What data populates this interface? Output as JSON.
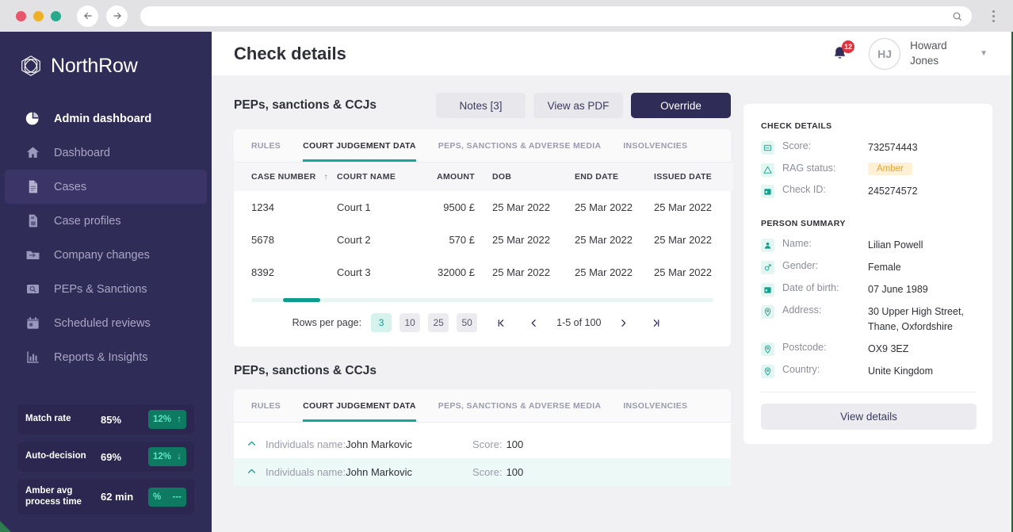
{
  "browser": {
    "back_icon": "arrow-left-icon",
    "forward_icon": "arrow-right-icon",
    "url_value": "",
    "url_placeholder": "",
    "search_icon": "search-icon",
    "menu_icon": "kebab-menu-icon"
  },
  "sidebar": {
    "brand": "NorthRow",
    "logo_icon": "northrow-hexagon-logo",
    "items": [
      {
        "label": "Admin dashboard",
        "icon": "pie-chart-icon",
        "state": "bold"
      },
      {
        "label": "Dashboard",
        "icon": "home-icon",
        "state": "normal"
      },
      {
        "label": "Cases",
        "icon": "document-icon",
        "state": "selected"
      },
      {
        "label": "Case profiles",
        "icon": "document-save-icon",
        "state": "normal"
      },
      {
        "label": "Company changes",
        "icon": "folder-transfer-icon",
        "state": "normal"
      },
      {
        "label": "PEPs & Sanctions",
        "icon": "folder-search-icon",
        "state": "normal"
      },
      {
        "label": "Scheduled reviews",
        "icon": "calendar-icon",
        "state": "normal"
      },
      {
        "label": "Reports & Insights",
        "icon": "bar-chart-icon",
        "state": "normal"
      }
    ],
    "stats": [
      {
        "label": "Match rate",
        "value": "85%",
        "delta": "12%",
        "trend": "↑"
      },
      {
        "label": "Auto-decision",
        "value": "69%",
        "delta": "12%",
        "trend": "↓"
      },
      {
        "label": "Amber avg process time",
        "value": "62 min",
        "delta": "%",
        "trend": "---"
      }
    ]
  },
  "header": {
    "title": "Check details",
    "bell_icon": "notification-bell-icon",
    "notification_count": "12",
    "avatar_initials": "HJ",
    "user_name_line1": "Howard",
    "user_name_line2": "Jones",
    "caret_icon": "chevron-down-icon"
  },
  "top_section": {
    "title": "PEPs, sanctions & CCJs",
    "buttons": {
      "notes": "Notes [3]",
      "view_pdf": "View as PDF",
      "override": "Override"
    },
    "tabs": [
      {
        "label": "Rules",
        "active": false
      },
      {
        "label": "Court judgement data",
        "active": true
      },
      {
        "label": "PEPs, sanctions & adverse media",
        "active": false
      },
      {
        "label": "Insolvencies",
        "active": false
      }
    ],
    "table": {
      "columns": [
        "Case number",
        "Court name",
        "Amount",
        "DOB",
        "End date",
        "Issued date"
      ],
      "sort_icon": "sort-ascending-icon",
      "rows": [
        [
          "1234",
          "Court 1",
          "9500 £",
          "25 Mar 2022",
          "25 Mar 2022",
          "25 Mar 2022"
        ],
        [
          "5678",
          "Court 2",
          "570 £",
          "25 Mar 2022",
          "25 Mar 2022",
          "25 Mar 2022"
        ],
        [
          "8392",
          "Court 3",
          "32000 £",
          "25 Mar 2022",
          "25 Mar 2022",
          "25 Mar 2022"
        ]
      ]
    },
    "pagination": {
      "rows_label": "Rows per page:",
      "options": [
        "3",
        "10",
        "25",
        "50"
      ],
      "selected": "3",
      "range": "1-5 of 100",
      "first_icon": "first-page-icon",
      "prev_icon": "previous-page-icon",
      "next_icon": "next-page-icon",
      "last_icon": "last-page-icon"
    }
  },
  "check_details": {
    "heading": "Check details",
    "rows": [
      {
        "icon": "score-card-icon",
        "key": "Score:",
        "value": "732574443",
        "type": "text"
      },
      {
        "icon": "warning-triangle-icon",
        "key": "RAG status:",
        "value": "Amber",
        "type": "badge"
      },
      {
        "icon": "calendar-icon",
        "key": "Check ID:",
        "value": "245274572",
        "type": "text"
      }
    ]
  },
  "person_summary": {
    "heading": "Person summary",
    "rows": [
      {
        "icon": "user-icon",
        "key": "Name:",
        "value": "Lilian Powell"
      },
      {
        "icon": "gender-icon",
        "key": "Gender:",
        "value": "Female"
      },
      {
        "icon": "calendar-icon",
        "key": "Date of birth:",
        "value": "07 June 1989"
      },
      {
        "icon": "location-pin-icon",
        "key": "Address:",
        "value": "30 Upper High Street, Thane, Oxfordshire"
      },
      {
        "icon": "location-pin-icon",
        "key": "Postcode:",
        "value": "OX9 3EZ"
      },
      {
        "icon": "location-pin-icon",
        "key": "Country:",
        "value": "Unite Kingdom"
      }
    ],
    "view_details_button": "View details"
  },
  "bottom_section": {
    "title": "PEPs, sanctions & CCJs",
    "tabs": [
      {
        "label": "Rules",
        "active": false
      },
      {
        "label": "Court judgement data",
        "active": true
      },
      {
        "label": "PEPs, sanctions & adverse media",
        "active": false
      },
      {
        "label": "Insolvencies",
        "active": false
      }
    ],
    "rows": [
      {
        "chevron": "chevron-up-icon",
        "name_label": "Individuals name:",
        "name_value": "John Markovic",
        "score_label": "Score:",
        "score_value": "100",
        "highlighted": false
      },
      {
        "chevron": "chevron-up-icon",
        "name_label": "Individuals name:",
        "name_value": "John Markovic",
        "score_label": "Score:",
        "score_value": "100",
        "highlighted": true
      }
    ]
  },
  "colors": {
    "sidebar_bg": "#302c58",
    "accent_teal": "#13a08f",
    "amber": "#e0a53b",
    "notification_red": "#e0323c"
  }
}
